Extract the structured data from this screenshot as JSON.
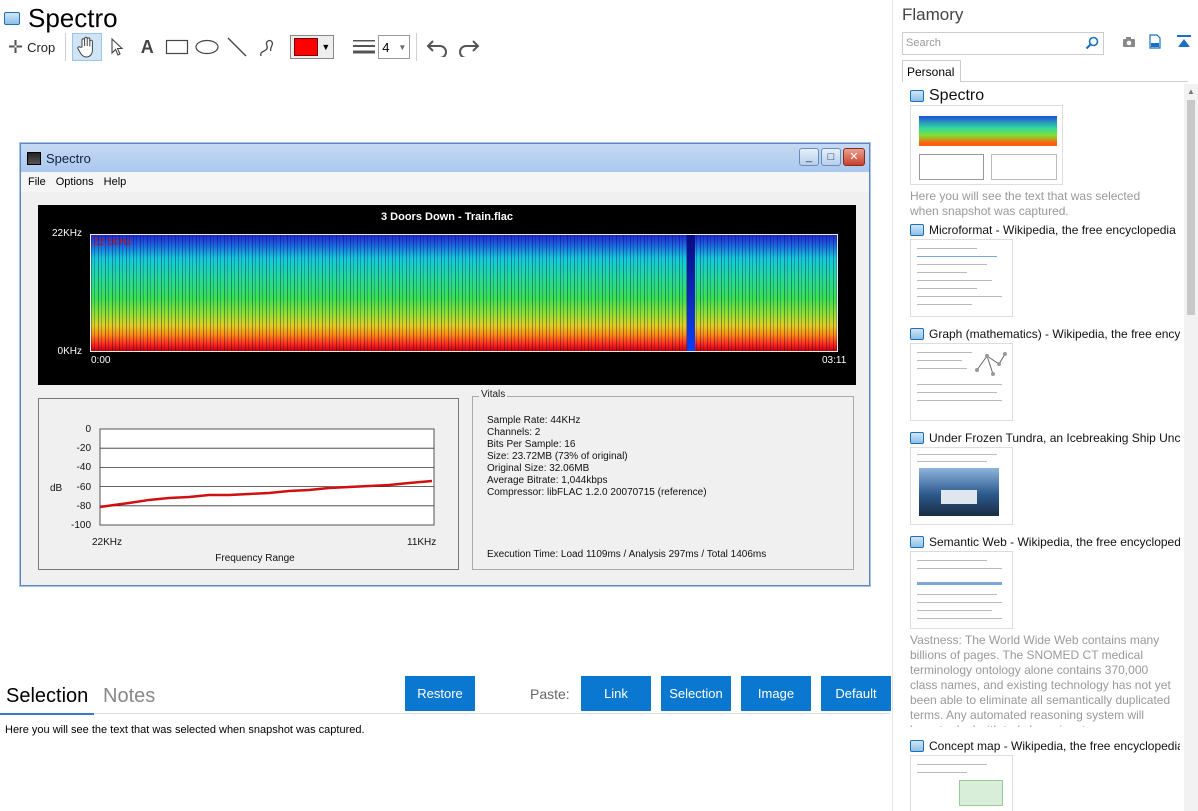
{
  "app": {
    "title": "Spectro"
  },
  "toolbar": {
    "crop_label": "Crop",
    "pen_color": "#ff0000",
    "line_width": "4",
    "tools": [
      "hand-icon",
      "pointer-icon",
      "text-icon",
      "rectangle-icon",
      "ellipse-icon",
      "line-icon",
      "freehand-icon"
    ]
  },
  "snapshot": {
    "window_title": "Spectro",
    "menu": [
      "File",
      "Options",
      "Help"
    ],
    "spectrum": {
      "track_title": "3 Doors Down - Train.flac",
      "peak_label": "22.1KHz",
      "y_top": "22KHz",
      "y_bottom": "0KHz",
      "x_start": "0:00",
      "x_end": "03:11"
    },
    "graph": {
      "y_label": "dB",
      "x_label": "Frequency Range",
      "x_start": "22KHz",
      "x_end": "11KHz",
      "y_ticks": [
        "0",
        "-20",
        "-40",
        "-60",
        "-80",
        "-100"
      ]
    },
    "vitals": {
      "title": "Vitals",
      "lines": [
        "Sample Rate: 44KHz",
        "Channels: 2",
        "Bits Per Sample: 16",
        "Size: 23.72MB (73% of original)",
        "Original Size: 32.06MB",
        "Average Bitrate: 1,044kbps",
        "Compressor: libFLAC 1.2.0 20070715 (reference)"
      ],
      "execution": "Execution Time: Load 1109ms / Analysis 297ms / Total 1406ms"
    }
  },
  "bottom": {
    "tab_selection": "Selection",
    "tab_notes": "Notes",
    "restore_label": "Restore",
    "paste_label": "Paste:",
    "link_label": "Link",
    "selection_label": "Selection",
    "image_label": "Image",
    "default_label": "Default",
    "selection_text": "Here you will see the text that was selected when snapshot was captured."
  },
  "sidebar": {
    "title": "Flamory",
    "search_placeholder": "Search",
    "tab": "Personal",
    "entries": [
      {
        "title": "Spectro",
        "desc": "Here you will see the text that was selected when snapshot was captured."
      },
      {
        "title": "Microformat - Wikipedia, the free encyclopedia"
      },
      {
        "title": "Graph (mathematics) - Wikipedia, the free encyclopedia"
      },
      {
        "title": "Under Frozen Tundra, an Icebreaking Ship Uncovers Secrets"
      },
      {
        "title": "Semantic Web - Wikipedia, the free encyclopedia",
        "desc": "Vastness: The World Wide Web contains many billions of pages. The SNOMED CT medical terminology ontology alone contains 370,000 class names, and existing technology has not yet been able to eliminate all semantically duplicated terms. Any automated reasoning system will have to deal with truly huge inputs."
      },
      {
        "title": "Concept map - Wikipedia, the free encyclopedia"
      }
    ]
  }
}
